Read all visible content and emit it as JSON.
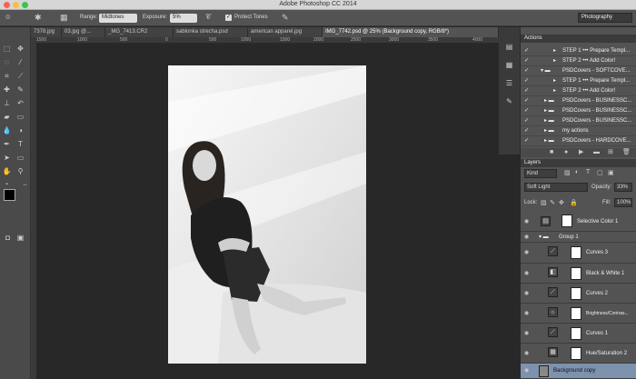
{
  "app": {
    "title": "Adobe Photoshop CC 2014"
  },
  "options": {
    "range_label": "Range:",
    "range_value": "Midtones",
    "exposure_label": "Exposure:",
    "exposure_value": "5%",
    "protect_tones": "Protect Tones",
    "workspace": "Photography"
  },
  "tabs": [
    {
      "label": "7378.jpg"
    },
    {
      "label": "03.jpg @..."
    },
    {
      "label": "_MG_7413.CR2"
    },
    {
      "label": "sablonka strecha.psd"
    },
    {
      "label": "american apparel.jpg"
    },
    {
      "label": "IMG_7742.psd @ 25% (Background copy, RGB/8*)"
    }
  ],
  "ruler": {
    "ticks": [
      "1500",
      "1000",
      "500",
      "0",
      "500",
      "1000",
      "1500",
      "2000",
      "2500",
      "3000",
      "3500",
      "4000"
    ]
  },
  "actions": {
    "title": "Actions",
    "items": [
      {
        "label": "STEP 1 ••• Prepare Templ..."
      },
      {
        "label": "STEP 2 ••• Add Color!"
      },
      {
        "label": "PSDCovers - SOFTCOVE..."
      },
      {
        "label": "STEP 1 ••• Prepare Templ..."
      },
      {
        "label": "STEP 2 ••• Add Color!"
      },
      {
        "label": "PSDCovers - BUSINESSC..."
      },
      {
        "label": "PSDCovers - BUSINESSC..."
      },
      {
        "label": "PSDCovers - BUSINESSC..."
      },
      {
        "label": "my actions"
      },
      {
        "label": "PSDCovers - HARDCOVE..."
      }
    ]
  },
  "layers": {
    "title": "Layers",
    "kind": "Kind",
    "blend_mode": "Soft Light",
    "opacity_label": "Opacity:",
    "opacity_value": "33%",
    "lock_label": "Lock:",
    "fill_label": "Fill:",
    "fill_value": "100%",
    "items": [
      {
        "name": "Selective Color 1"
      },
      {
        "name": "Group 1"
      },
      {
        "name": "Curves 3"
      },
      {
        "name": "Black & White 1"
      },
      {
        "name": "Curves 2"
      },
      {
        "name": "Brightness/Contras..."
      },
      {
        "name": "Curves 1"
      },
      {
        "name": "Hue/Saturation 2"
      },
      {
        "name": "Background copy"
      }
    ]
  }
}
